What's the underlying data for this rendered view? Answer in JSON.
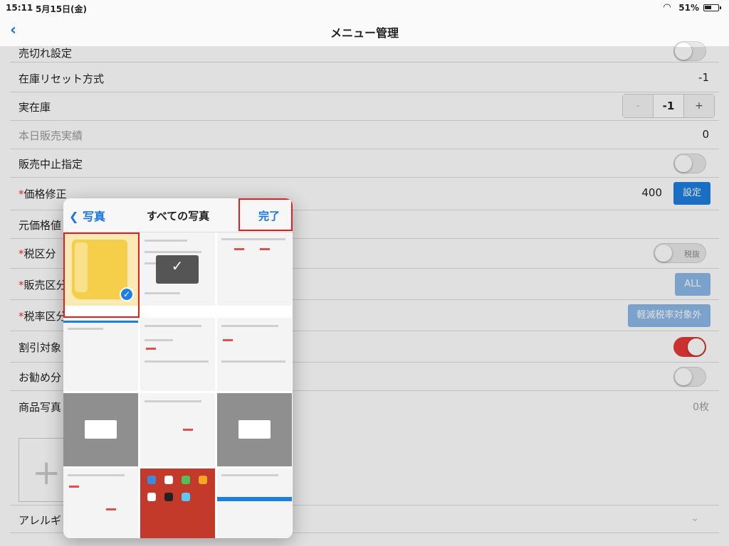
{
  "status": {
    "time": "15:11",
    "date": "5月15日(金)",
    "battery": "51%"
  },
  "nav": {
    "back_icon": "chevron-left-icon",
    "title": "メニュー管理"
  },
  "rows": {
    "soldout": {
      "label": "売切れ設定",
      "toggle_on": false
    },
    "stock_reset": {
      "label": "在庫リセット方式",
      "value": "-1"
    },
    "actual_stock": {
      "label": "実在庫",
      "minus": "-",
      "value": "-1",
      "plus": "+"
    },
    "today_sales": {
      "label": "本日販売実績",
      "value": "0"
    },
    "stop_sale": {
      "label": "販売中止指定",
      "toggle_on": false
    },
    "price_edit": {
      "req": "*",
      "label": "価格修正",
      "value": "400",
      "button": "設定"
    },
    "orig_price": {
      "label": "元価格値"
    },
    "tax_class": {
      "req": "*",
      "label": "税区分",
      "toggle_label": "税抜",
      "toggle_on": false
    },
    "sales_class": {
      "req": "*",
      "label": "販売区分",
      "button": "ALL"
    },
    "tax_rate": {
      "req": "*",
      "label": "税率区分",
      "button": "軽減税率対象外"
    },
    "discount": {
      "label": "割引対象",
      "toggle_on": true
    },
    "recommend": {
      "label": "お勧め分",
      "toggle_on": false
    },
    "product_photo": {
      "label": "商品写真",
      "value": "0枚"
    },
    "allergy": {
      "label": "アレルギ"
    }
  },
  "picker": {
    "back_label": "写真",
    "title": "すべての写真",
    "done_label": "完了"
  },
  "colors": {
    "accent": "#1e7fe0",
    "toggle_on": "#e53935",
    "highlight": "#e02020"
  }
}
